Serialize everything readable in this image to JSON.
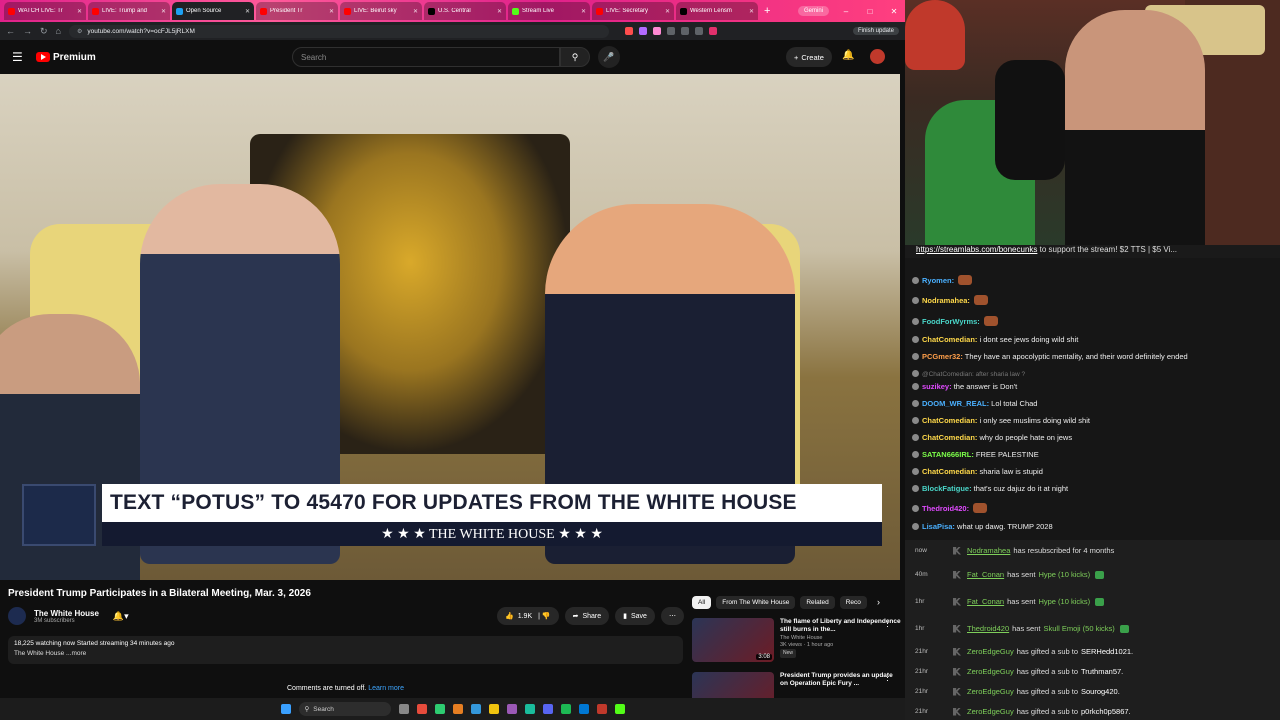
{
  "browser": {
    "tabs": [
      {
        "label": "WATCH LIVE: Tr",
        "color": "#ff0000"
      },
      {
        "label": "LIVE: Trump and",
        "color": "#ff0000"
      },
      {
        "label": "Open Source",
        "color": "#1da1f2",
        "active": true
      },
      {
        "label": "President Tr",
        "color": "#ff0000"
      },
      {
        "label": "LIVE: Beirut sky",
        "color": "#ff0000"
      },
      {
        "label": "U.S. Central",
        "color": "#000000"
      },
      {
        "label": "Stream Live",
        "color": "#53fc18"
      },
      {
        "label": "LIVE: Secretary",
        "color": "#ff0000"
      },
      {
        "label": "Western Lensm",
        "color": "#000000"
      }
    ],
    "new_tab": "+",
    "gemini_label": "Gemini",
    "url": "youtube.com/watch?v=ocFJL5jRLXM",
    "finish_update": "Finish update"
  },
  "youtube": {
    "logo_text": "Premium",
    "search_placeholder": "Search",
    "create_label": "Create",
    "video_title": "President Trump Participates in a Bilateral Meeting, Mar. 3, 2026",
    "channel_name": "The White House",
    "channel_subs": "3M subscribers",
    "like_count": "1.9K",
    "share_label": "Share",
    "save_label": "Save",
    "desc_line1": "18,225 watching now  Started streaming 34 minutes ago",
    "desc_line2": "The White House ...more",
    "comments_off": "Comments are turned off.",
    "learn_more": "Learn more",
    "lower_third_main": "TEXT “POTUS” TO 45470 FOR UPDATES FROM THE WHITE HOUSE",
    "lower_third_sub": "★ ★ ★  THE WHITE HOUSE  ★ ★ ★",
    "chips": [
      "All",
      "From The White House",
      "Related",
      "Reco"
    ],
    "related": [
      {
        "title": "The flame of Liberty and Independence still burns in the...",
        "channel": "The White House",
        "meta": "3K views · 1 hour ago",
        "badge": "New",
        "duration": "3:08"
      },
      {
        "title": "President Trump provides an update on Operation Epic Fury ...",
        "channel": "",
        "meta": "",
        "badge": "",
        "duration": ""
      }
    ]
  },
  "taskbar": {
    "search_label": "Search"
  },
  "stream": {
    "ticker_link": "https://streamlabs.com/bonecunks",
    "ticker_text": " to support the stream! $2 TTS | $5 Vi...",
    "chat": [
      {
        "user": "Ryomen:",
        "msg": "",
        "color": "#4ab0ff",
        "emote": true
      },
      {
        "user": "Nodramahea:",
        "msg": "",
        "color": "#ffd94a",
        "emote": true
      },
      {
        "user": "FoodForWyrms:",
        "msg": "",
        "color": "#4ad6c9",
        "emote": true
      },
      {
        "user": "ChatComedian:",
        "msg": " i dont see jews doing wild shit",
        "color": "#ffd94a"
      },
      {
        "user": "PCGmer32:",
        "msg": " They have an apocolyptic mentality, and their word definitely ended",
        "color": "#ff9f4a"
      },
      {
        "user": "",
        "msg": "@ChatComedian: after sharia law ?",
        "color": "#777",
        "reply": true
      },
      {
        "user": "suzikey:",
        "msg": " the answer is Don't",
        "color": "#e04aff"
      },
      {
        "user": "DOOM_WR_REAL:",
        "msg": " Lol total Chad",
        "color": "#4ab0ff"
      },
      {
        "user": "ChatComedian:",
        "msg": " i only see muslims doing wild shit",
        "color": "#ffd94a"
      },
      {
        "user": "ChatComedian:",
        "msg": " why do people hate on jews",
        "color": "#ffd94a"
      },
      {
        "user": "SATAN666IRL:",
        "msg": " FREE PALESTINE",
        "color": "#7dff4a"
      },
      {
        "user": "ChatComedian:",
        "msg": " sharia law is stupid",
        "color": "#ffd94a"
      },
      {
        "user": "BlockFatigue:",
        "msg": " that's cuz dajuz do it at night",
        "color": "#4ad6c9"
      },
      {
        "user": "Thedroid420:",
        "msg": "",
        "color": "#e04aff",
        "emote": true
      },
      {
        "user": "LisaPisa:",
        "msg": " what up dawg. TRUMP 2028",
        "color": "#4ab0ff"
      }
    ],
    "events": [
      {
        "time": "now",
        "user": "Nodramahea",
        "text": "has resubscribed for 4 months",
        "highlight": "",
        "gift": false,
        "underline": true
      },
      {
        "time": "40m",
        "user": "Fat_Conan",
        "text": "has sent",
        "highlight": "Hype (10 kicks)",
        "gift": true,
        "underline": true
      },
      {
        "time": "1hr",
        "user": "Fat_Conan",
        "text": "has sent",
        "highlight": "Hype (10 kicks)",
        "gift": true,
        "underline": true
      },
      {
        "time": "1hr",
        "user": "Thedroid420",
        "text": "has sent",
        "highlight": "Skull Emoji (50 kicks)",
        "gift": true,
        "underline": true
      },
      {
        "time": "21hr",
        "user": "ZeroEdgeGuy",
        "text": "has gifted a sub to",
        "highlight": "SERHedd1021.",
        "gift": false,
        "underline": false
      },
      {
        "time": "21hr",
        "user": "ZeroEdgeGuy",
        "text": "has gifted a sub to",
        "highlight": "Truthman57.",
        "gift": false,
        "underline": false
      },
      {
        "time": "21hr",
        "user": "ZeroEdgeGuy",
        "text": "has gifted a sub to",
        "highlight": "Sourog420.",
        "gift": false,
        "underline": false
      },
      {
        "time": "21hr",
        "user": "ZeroEdgeGuy",
        "text": "has gifted a sub to",
        "highlight": "p0rkch0p5867.",
        "gift": false,
        "underline": false
      }
    ]
  }
}
